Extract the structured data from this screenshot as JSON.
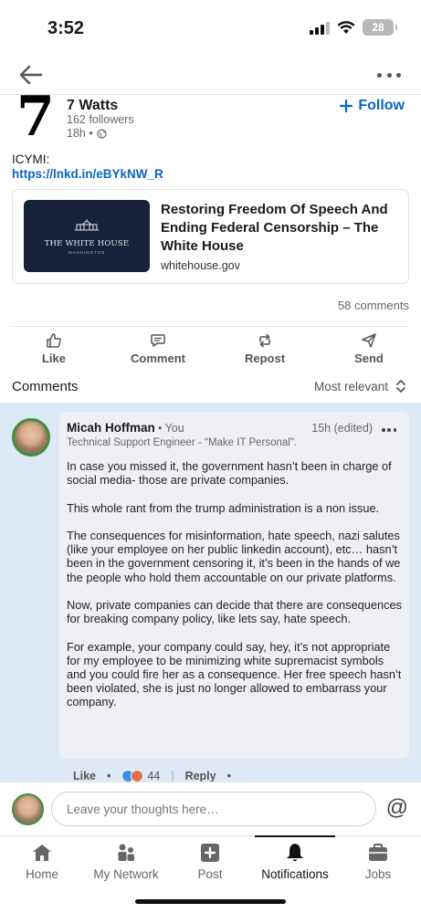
{
  "status_bar": {
    "time": "3:52",
    "battery": "28"
  },
  "post": {
    "author": {
      "logo": "7",
      "name": "7 Watts",
      "followers": "162 followers",
      "time": "18h •"
    },
    "follow_label": "Follow",
    "text": "ICYMI:",
    "link": "https://lnkd.in/eBYkNW_R",
    "card": {
      "thumb_title": "THE WHITE HOUSE",
      "thumb_sub": "WASHINGTON",
      "title": "Restoring Freedom Of Speech And Ending Federal Censorship – The White House",
      "domain": "whitehouse.gov"
    },
    "comments_count": "58 comments"
  },
  "actions": [
    {
      "label": "Like",
      "icon": "thumbs-up-icon"
    },
    {
      "label": "Comment",
      "icon": "comment-icon"
    },
    {
      "label": "Repost",
      "icon": "repost-icon"
    },
    {
      "label": "Send",
      "icon": "send-icon"
    }
  ],
  "comments_section": {
    "heading": "Comments",
    "sort": "Most relevant"
  },
  "comment": {
    "name": "Micah Hoffman",
    "you": "• You",
    "time": "15h (edited)",
    "headline": "Technical Support Engineer - \"Make IT Personal\".",
    "paragraphs": [
      "In case you missed it, the government hasn’t been in charge of social media- those are private companies.",
      "This whole rant from the trump administration is a non issue.",
      "The consequences for misinformation, hate speech, nazi salutes (like your employee on her public linkedin account), etc… hasn’t been in the government censoring it, it’s been in the hands of we the people who hold them accountable on our private platforms.",
      "Now, private companies can decide that there are consequences for breaking company policy, like lets say, hate speech.",
      "For example, your company could say, hey, it’s not appropriate for my employee to be minimizing white supremacist symbols and you could fire her as a consequence. Her free speech hasn’t been violated, she is just no longer allowed to embarrass your company."
    ],
    "like_label": "Like",
    "reaction_count": "44",
    "reply_label": "Reply"
  },
  "input": {
    "placeholder": "Leave your thoughts here…",
    "at_symbol": "@"
  },
  "bottom_nav": [
    {
      "label": "Home",
      "icon": "home-icon"
    },
    {
      "label": "My Network",
      "icon": "network-icon"
    },
    {
      "label": "Post",
      "icon": "post-icon"
    },
    {
      "label": "Notifications",
      "icon": "bell-icon",
      "active": true
    },
    {
      "label": "Jobs",
      "icon": "briefcase-icon"
    }
  ],
  "colors": {
    "accent": "#0a66c2",
    "comment_bg": "#dde9f6",
    "bubble_bg": "#eef0f3"
  }
}
